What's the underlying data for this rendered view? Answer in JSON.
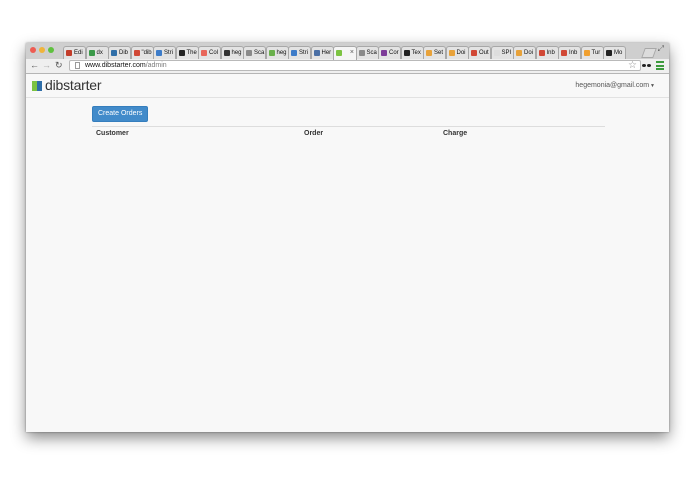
{
  "browser": {
    "tabs": [
      {
        "label": "Edi",
        "favicon_color": "#c33d2a"
      },
      {
        "label": "dx",
        "favicon_color": "#3b9a4a"
      },
      {
        "label": "Dib",
        "favicon_color": "#2f6ea8"
      },
      {
        "label": "\"dib",
        "favicon_color": "#d14836"
      },
      {
        "label": "Stri",
        "favicon_color": "#3d7cc9"
      },
      {
        "label": "The",
        "favicon_color": "#222222"
      },
      {
        "label": "Col",
        "favicon_color": "#e8665a"
      },
      {
        "label": "heg",
        "favicon_color": "#333333"
      },
      {
        "label": "Sca",
        "favicon_color": "#8a8a8a"
      },
      {
        "label": "heg",
        "favicon_color": "#6ab04c"
      },
      {
        "label": "Stri",
        "favicon_color": "#3d7cc9"
      },
      {
        "label": "Her",
        "favicon_color": "#4a6fa5"
      },
      {
        "label": "",
        "favicon_color": "#7cc341"
      },
      {
        "label": "Sca",
        "favicon_color": "#8a8a8a"
      },
      {
        "label": "Cor",
        "favicon_color": "#7d3c98"
      },
      {
        "label": "Tex",
        "favicon_color": "#222222"
      },
      {
        "label": "Set",
        "favicon_color": "#e8a23a"
      },
      {
        "label": "Doi",
        "favicon_color": "#e8a23a"
      },
      {
        "label": "Out",
        "favicon_color": "#d14836"
      },
      {
        "label": "SPI",
        "favicon_color": "#dddddd"
      },
      {
        "label": "Doi",
        "favicon_color": "#e8a23a"
      },
      {
        "label": "Inb",
        "favicon_color": "#d14836"
      },
      {
        "label": "Inb",
        "favicon_color": "#d14836"
      },
      {
        "label": "Tur",
        "favicon_color": "#f0a030"
      },
      {
        "label": "Mo",
        "favicon_color": "#222222"
      }
    ],
    "url_host": "www.dibstarter.com",
    "url_path": "/admin"
  },
  "site": {
    "brand": "dibstarter",
    "brand_colors": {
      "green": "#7cc341",
      "blue": "#2f6ea8"
    },
    "account_email": "hegemonia@gmail.com"
  },
  "main": {
    "create_button": "Create Orders",
    "button_color": "#428bca",
    "columns": [
      "Customer",
      "Order",
      "Charge"
    ]
  }
}
